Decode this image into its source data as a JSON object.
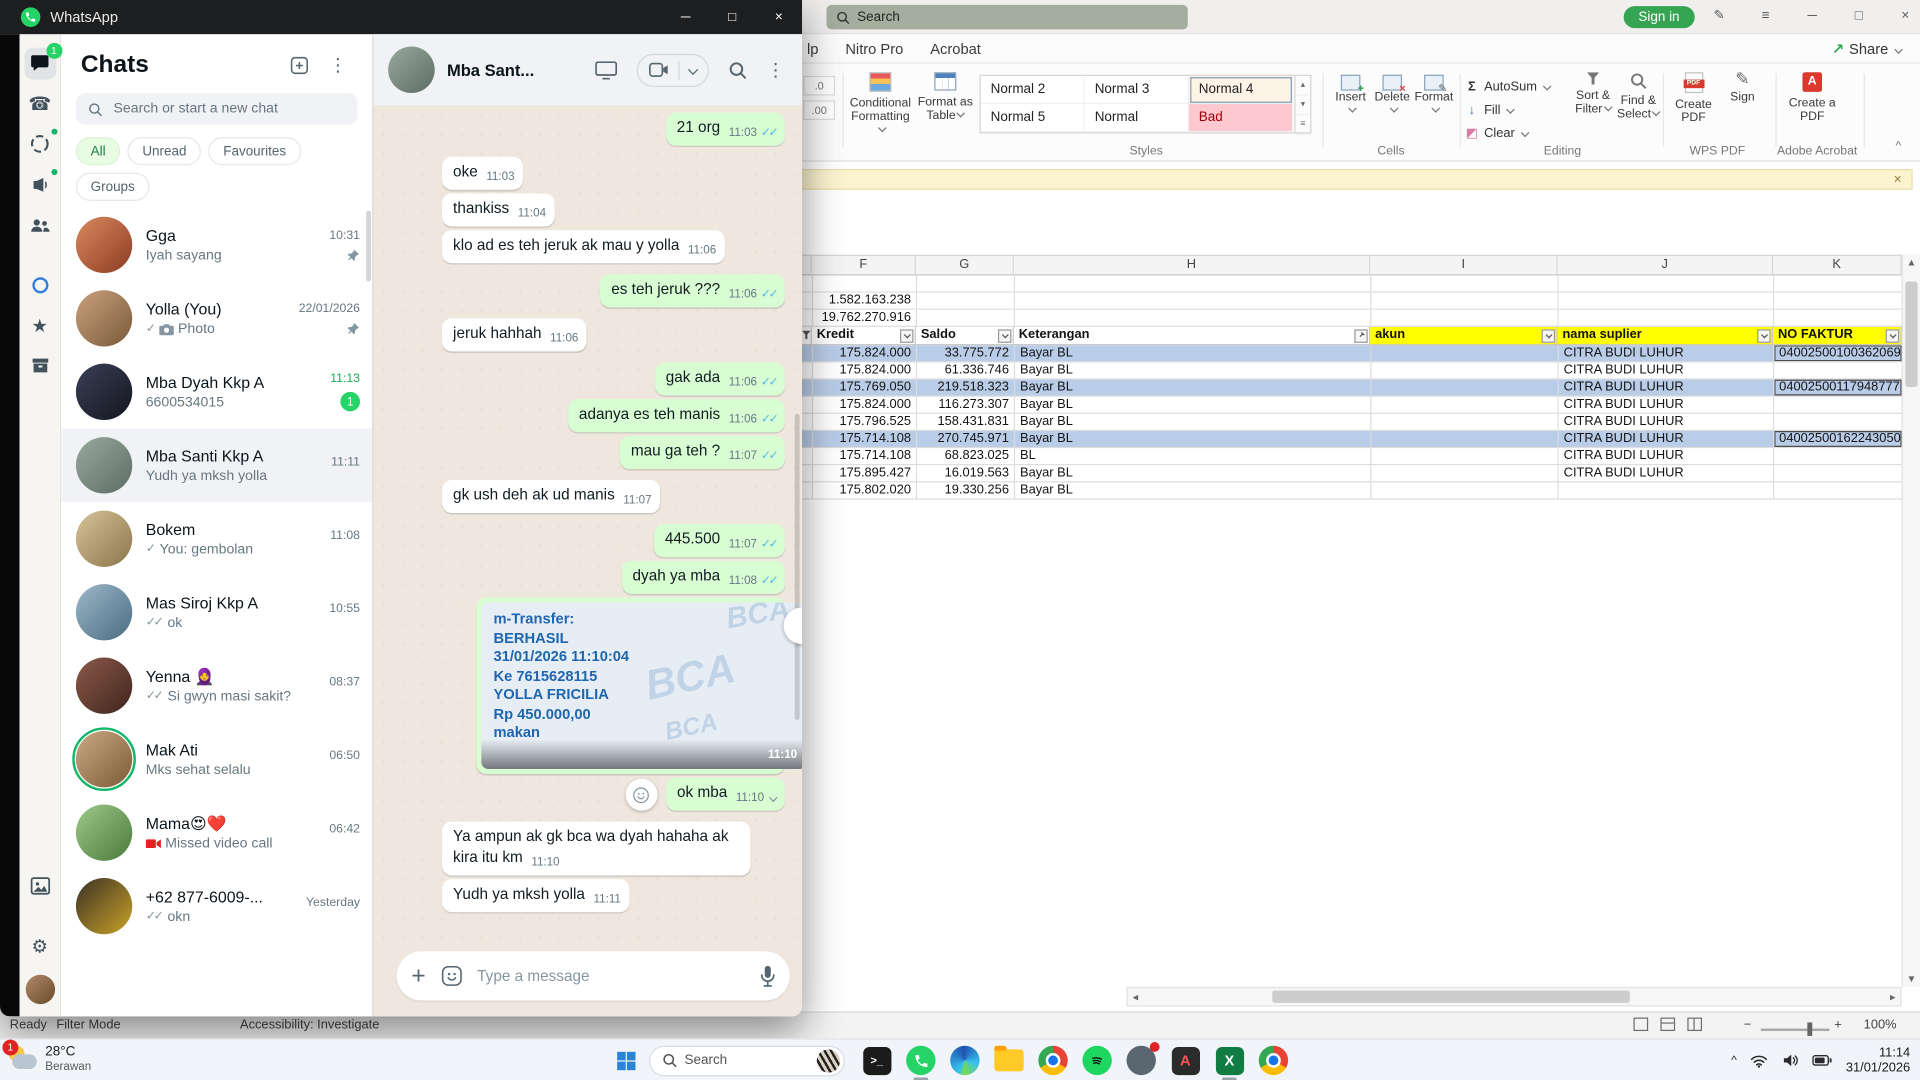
{
  "colors": {
    "wa_green": "#25d366",
    "unread_green": "#1fa855",
    "bubble_out": "#d9fdd3",
    "bubble_in": "#ffffff",
    "chat_bg": "#efe7dd",
    "excel_highlight": "#b9cce8",
    "header_yellow": "#ffff00",
    "bad_bg": "#ffc7ce",
    "bad_fg": "#9c0006",
    "receipt_blue": "#1f66b0"
  },
  "whatsapp": {
    "title": "WhatsApp",
    "chats_panel": {
      "title": "Chats",
      "search_placeholder": "Search or start a new chat",
      "filters": [
        "All",
        "Unread",
        "Favourites",
        "Groups"
      ],
      "chats": [
        {
          "name": "Gga",
          "time": "10:31",
          "preview": "Iyah sayang",
          "pinned": true,
          "avatar": [
            "#d98a5f",
            "#8c3b22"
          ]
        },
        {
          "name": "Yolla (You)",
          "time": "22/01/2026",
          "preview": "Photo",
          "ticks": "✓",
          "icon": "camera",
          "pinned": true,
          "avatar": [
            "#c9a27c",
            "#7a5a3a"
          ]
        },
        {
          "name": "Mba Dyah Kkp A",
          "time": "11:13",
          "preview": "6600534015",
          "unread": true,
          "badge": "1",
          "avatar": [
            "#3a3f55",
            "#14161f"
          ]
        },
        {
          "name": "Mba Santi Kkp A",
          "time": "11:11",
          "preview": "Yudh ya mksh yolla",
          "selected": true,
          "avatar": [
            "#9aa9a0",
            "#5c6b63"
          ]
        },
        {
          "name": "Bokem",
          "time": "11:08",
          "preview": "You: gembolan",
          "ticks": "✓",
          "avatar": [
            "#d8c49a",
            "#8a744a"
          ]
        },
        {
          "name": "Mas Siroj Kkp A",
          "time": "10:55",
          "preview": "ok",
          "ticks": "✓✓",
          "avatar": [
            "#9db8c9",
            "#4a6b82"
          ]
        },
        {
          "name": "Yenna 🧕",
          "time": "08:37",
          "preview": "Si gwyn masi sakit?",
          "ticks": "✓✓",
          "avatar": [
            "#8c5a4a",
            "#3f241c"
          ]
        },
        {
          "name": "Mak Ati",
          "time": "06:50",
          "preview": "Mks sehat selalu",
          "status_ring": true,
          "avatar": [
            "#caa984",
            "#7c5a36"
          ]
        },
        {
          "name": "Mama😍❤️",
          "time": "06:42",
          "preview": "Missed video call",
          "icon": "missed-video",
          "avatar": [
            "#9ec98a",
            "#4a7a3a"
          ]
        },
        {
          "name": "+62 877-6009-...",
          "time": "Yesterday",
          "preview": "okn",
          "ticks": "✓✓",
          "avatar": [
            "#3a3226",
            "#c9a227"
          ]
        }
      ]
    },
    "conversation": {
      "contact_name": "Mba Sant...",
      "input_placeholder": "Type a message",
      "messages": [
        {
          "dir": "out",
          "text": "21 org",
          "time": "11:03",
          "ticks": true
        },
        {
          "dir": "in",
          "text": "oke",
          "time": "11:03"
        },
        {
          "dir": "in",
          "text": "thankiss",
          "time": "11:04"
        },
        {
          "dir": "in",
          "text": "klo ad es teh jeruk ak mau y yolla",
          "time": "11:06"
        },
        {
          "dir": "out",
          "text": "es teh jeruk ???",
          "time": "11:06",
          "ticks": true
        },
        {
          "dir": "in",
          "text": "jeruk hahhah",
          "time": "11:06"
        },
        {
          "dir": "out",
          "text": "gak ada",
          "time": "11:06",
          "ticks": true
        },
        {
          "dir": "out",
          "text": "adanya es teh manis",
          "time": "11:06",
          "ticks": true
        },
        {
          "dir": "out",
          "text": "mau ga teh ?",
          "time": "11:07",
          "ticks": true
        },
        {
          "dir": "in",
          "text": "gk ush deh ak ud manis",
          "time": "11:07"
        },
        {
          "dir": "out",
          "text": "445.500",
          "time": "11:07",
          "ticks": true
        },
        {
          "dir": "out",
          "text": "dyah ya mba",
          "time": "11:08",
          "ticks": true
        },
        {
          "dir": "out",
          "type": "image",
          "time": "11:10",
          "watermark": "BCA",
          "image_lines": [
            "m-Transfer:",
            "BERHASIL",
            "31/01/2026 11:10:04",
            "Ke 7615628115",
            "YOLLA FRICILIA",
            "Rp 450.000,00",
            "makan"
          ]
        },
        {
          "dir": "out",
          "text": "ok mba",
          "time": "11:10",
          "reaction_button": true,
          "menu_chevron": true
        },
        {
          "dir": "in",
          "text": "Ya ampun ak gk bca wa dyah hahaha ak kira itu km",
          "time": "11:10"
        },
        {
          "dir": "in",
          "text": "Yudh ya mksh yolla",
          "time": "11:11"
        }
      ]
    }
  },
  "spreadsheet": {
    "titlebar": {
      "search_placeholder": "Search",
      "sign_in": "Sign in"
    },
    "tabs": [
      "lp",
      "Nitro Pro",
      "Acrobat"
    ],
    "share_label": "Share",
    "ribbon": {
      "conditional_formatting": "Conditional Formatting",
      "format_as_table": "Format as Table",
      "styles": {
        "label": "Styles",
        "row1": [
          "Normal 2",
          "Normal 3",
          "Normal 4"
        ],
        "row2": [
          "Normal 5",
          "Normal",
          "Bad"
        ],
        "selected": "Normal 4"
      },
      "cells": {
        "label": "Cells",
        "buttons": [
          "Insert",
          "Delete",
          "Format"
        ]
      },
      "editing": {
        "label": "Editing",
        "small_buttons": [
          "AutoSum",
          "Fill",
          "Clear"
        ],
        "big_buttons": [
          "Sort & Filter",
          "Find & Select"
        ]
      },
      "wps_pdf": {
        "label": "WPS PDF",
        "buttons": [
          "Create PDF",
          "Sign"
        ]
      },
      "adobe": {
        "label": "Adobe Acrobat",
        "buttons": [
          "Create a PDF"
        ]
      }
    },
    "grid": {
      "columns": [
        "F",
        "G",
        "H",
        "I",
        "J",
        "K"
      ],
      "pre_values": [
        "1.582.163.238",
        "19.762.270.916"
      ],
      "header_row": [
        "Kredit",
        "Saldo",
        "Keterangan",
        "akun",
        "nama suplier",
        "NO FAKTUR"
      ],
      "rows": [
        {
          "kredit": "175.824.000",
          "saldo": "33.775.772",
          "ket": "Bayar BL",
          "akun": "",
          "suplier": "CITRA BUDI LUHUR",
          "faktur": "04002500100362069",
          "highlight": true
        },
        {
          "kredit": "175.824.000",
          "saldo": "61.336.746",
          "ket": "Bayar BL",
          "akun": "",
          "suplier": "CITRA BUDI LUHUR",
          "faktur": "",
          "highlight": false
        },
        {
          "kredit": "175.769.050",
          "saldo": "219.518.323",
          "ket": "Bayar BL",
          "akun": "",
          "suplier": "CITRA BUDI LUHUR",
          "faktur": "04002500117948777",
          "highlight": true
        },
        {
          "kredit": "175.824.000",
          "saldo": "116.273.307",
          "ket": "Bayar BL",
          "akun": "",
          "suplier": "CITRA BUDI LUHUR",
          "faktur": "",
          "highlight": false
        },
        {
          "kredit": "175.796.525",
          "saldo": "158.431.831",
          "ket": "Bayar BL",
          "akun": "",
          "suplier": "CITRA BUDI LUHUR",
          "faktur": "",
          "highlight": false
        },
        {
          "kredit": "175.714.108",
          "saldo": "270.745.971",
          "ket": "Bayar BL",
          "akun": "",
          "suplier": "CITRA BUDI LUHUR",
          "faktur": "04002500162243050",
          "highlight": true
        },
        {
          "kredit": "175.714.108",
          "saldo": "68.823.025",
          "ket": "BL",
          "akun": "",
          "suplier": "CITRA BUDI LUHUR",
          "faktur": "",
          "highlight": false
        },
        {
          "kredit": "175.895.427",
          "saldo": "16.019.563",
          "ket": "Bayar BL",
          "akun": "",
          "suplier": "CITRA BUDI LUHUR",
          "faktur": "",
          "highlight": false
        },
        {
          "kredit": "175.802.020",
          "saldo": "19.330.256",
          "ket": "Bayar BL",
          "akun": "",
          "suplier": "",
          "faktur": "",
          "highlight": false
        }
      ]
    },
    "status": {
      "ready": "Ready",
      "filter_mode": "Filter Mode",
      "accessibility": "Accessibility: Investigate",
      "zoom": "100%"
    }
  },
  "taskbar": {
    "weather": {
      "temp": "28°C",
      "condition": "Berawan",
      "badge": "1"
    },
    "search_label": "Search",
    "apps": [
      "terminal",
      "whatsapp",
      "edge",
      "file-explorer",
      "chrome",
      "spotify",
      "gray-app",
      "adobe",
      "excel",
      "browser"
    ],
    "clock": {
      "time": "11:14",
      "date": "31/01/2026"
    }
  }
}
